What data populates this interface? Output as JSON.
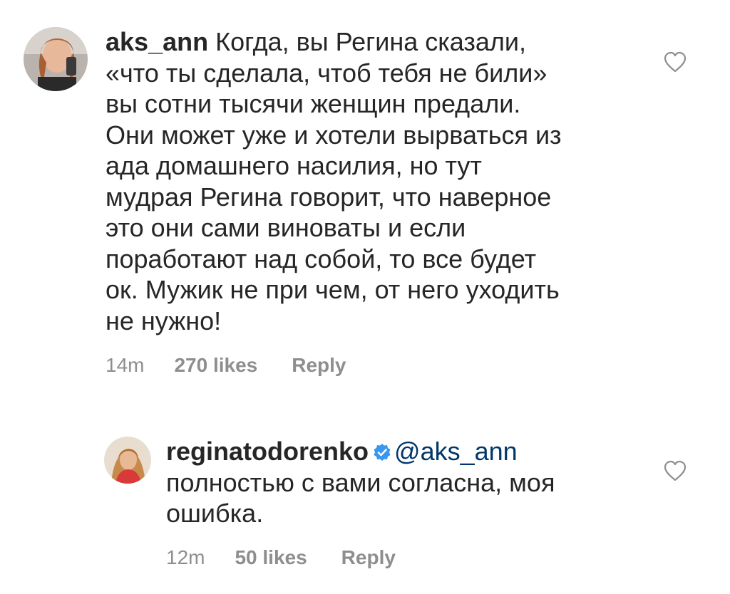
{
  "comments": [
    {
      "username": "aks_ann",
      "text_lines": [
        "Когда, вы Регина сказали,",
        "«что ты сделала, чтоб тебя не били»",
        "вы сотни тысячи женщин предали.",
        "Они может уже и хотели вырваться из",
        "ада домашнего насилия, но тут",
        "мудрая Регина говорит, что наверное",
        "это они сами виноваты и если",
        "поработают над собой, то все будет",
        "ок. Мужик не при чем, от него уходить",
        "не нужно!"
      ],
      "time": "14m",
      "likes": "270 likes",
      "reply": "Reply",
      "avatar_icon": "user-avatar"
    },
    {
      "username": "reginatodorenko",
      "verified": true,
      "mention": "@aks_ann",
      "text_lines": [
        "полностью с вами согласна, моя",
        "ошибка."
      ],
      "time": "12m",
      "likes": "50 likes",
      "reply": "Reply",
      "avatar_icon": "user-avatar"
    }
  ],
  "colors": {
    "text": "#262626",
    "meta": "#8e8e8e",
    "mention": "#00376b",
    "verified": "#3897f0"
  },
  "icons": {
    "like": "heart-icon",
    "verified": "verified-badge-icon"
  }
}
